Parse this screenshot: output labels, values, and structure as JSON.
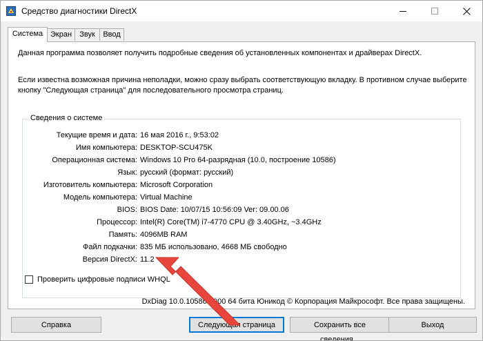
{
  "window": {
    "title": "Средство диагностики DirectX"
  },
  "tabs": [
    {
      "label": "Система",
      "active": true
    },
    {
      "label": "Экран",
      "active": false
    },
    {
      "label": "Звук",
      "active": false
    },
    {
      "label": "Ввод",
      "active": false
    }
  ],
  "description": {
    "line1": "Данная программа позволяет получить подробные сведения об установленных компонентах и драйверах DirectX.",
    "line2": "Если известна возможная причина неполадки, можно сразу выбрать соответствующую вкладку. В противном случае выберите",
    "line3": "кнопку \"Следующая страница\" для последовательного просмотра страниц."
  },
  "system_info": {
    "title": "Сведения о системе",
    "rows": [
      {
        "label": "Текущие время и дата:",
        "value": "16 мая 2016 г., 9:53:02"
      },
      {
        "label": "Имя компьютера:",
        "value": "DESKTOP-SCU475K"
      },
      {
        "label": "Операционная система:",
        "value": "Windows 10 Pro 64-разрядная (10.0, построение 10586)"
      },
      {
        "label": "Язык:",
        "value": "русский (формат: русский)"
      },
      {
        "label": "Изготовитель компьютера:",
        "value": "Microsoft Corporation"
      },
      {
        "label": "Модель компьютера:",
        "value": "Virtual Machine"
      },
      {
        "label": "BIOS:",
        "value": "BIOS Date: 10/07/15 10:56:09  Ver: 09.00.06"
      },
      {
        "label": "Процессор:",
        "value": "Intel(R) Core(TM) i7-4770 CPU @ 3.40GHz, ~3.4GHz"
      },
      {
        "label": "Память:",
        "value": "4096MB RAM"
      },
      {
        "label": "Файл подкачки:",
        "value": "835 МБ использовано, 4668 МБ свободно"
      },
      {
        "label": "Версия DirectX:",
        "value": "11.2"
      }
    ]
  },
  "checkbox": {
    "label": "Проверить цифровые подписи WHQL",
    "checked": false
  },
  "footer_note": "DxDiag 10.0.10586.0000 64 бита Юникод © Корпорация Майкрософт. Все права защищены.",
  "buttons": {
    "help": "Справка",
    "next_page": "Следующая страница",
    "save_all": "Сохранить все сведения...",
    "exit": "Выход"
  },
  "colors": {
    "arrow": "#e8453c",
    "default_button_border": "#0078d7",
    "window_bg": "#f0f0f0",
    "panel_bg": "#ffffff"
  },
  "icons": {
    "app": "directx-diagnostic-icon",
    "minimize": "minimize-icon",
    "maximize": "maximize-icon",
    "close": "close-icon",
    "annotation": "red-arrow-icon"
  }
}
